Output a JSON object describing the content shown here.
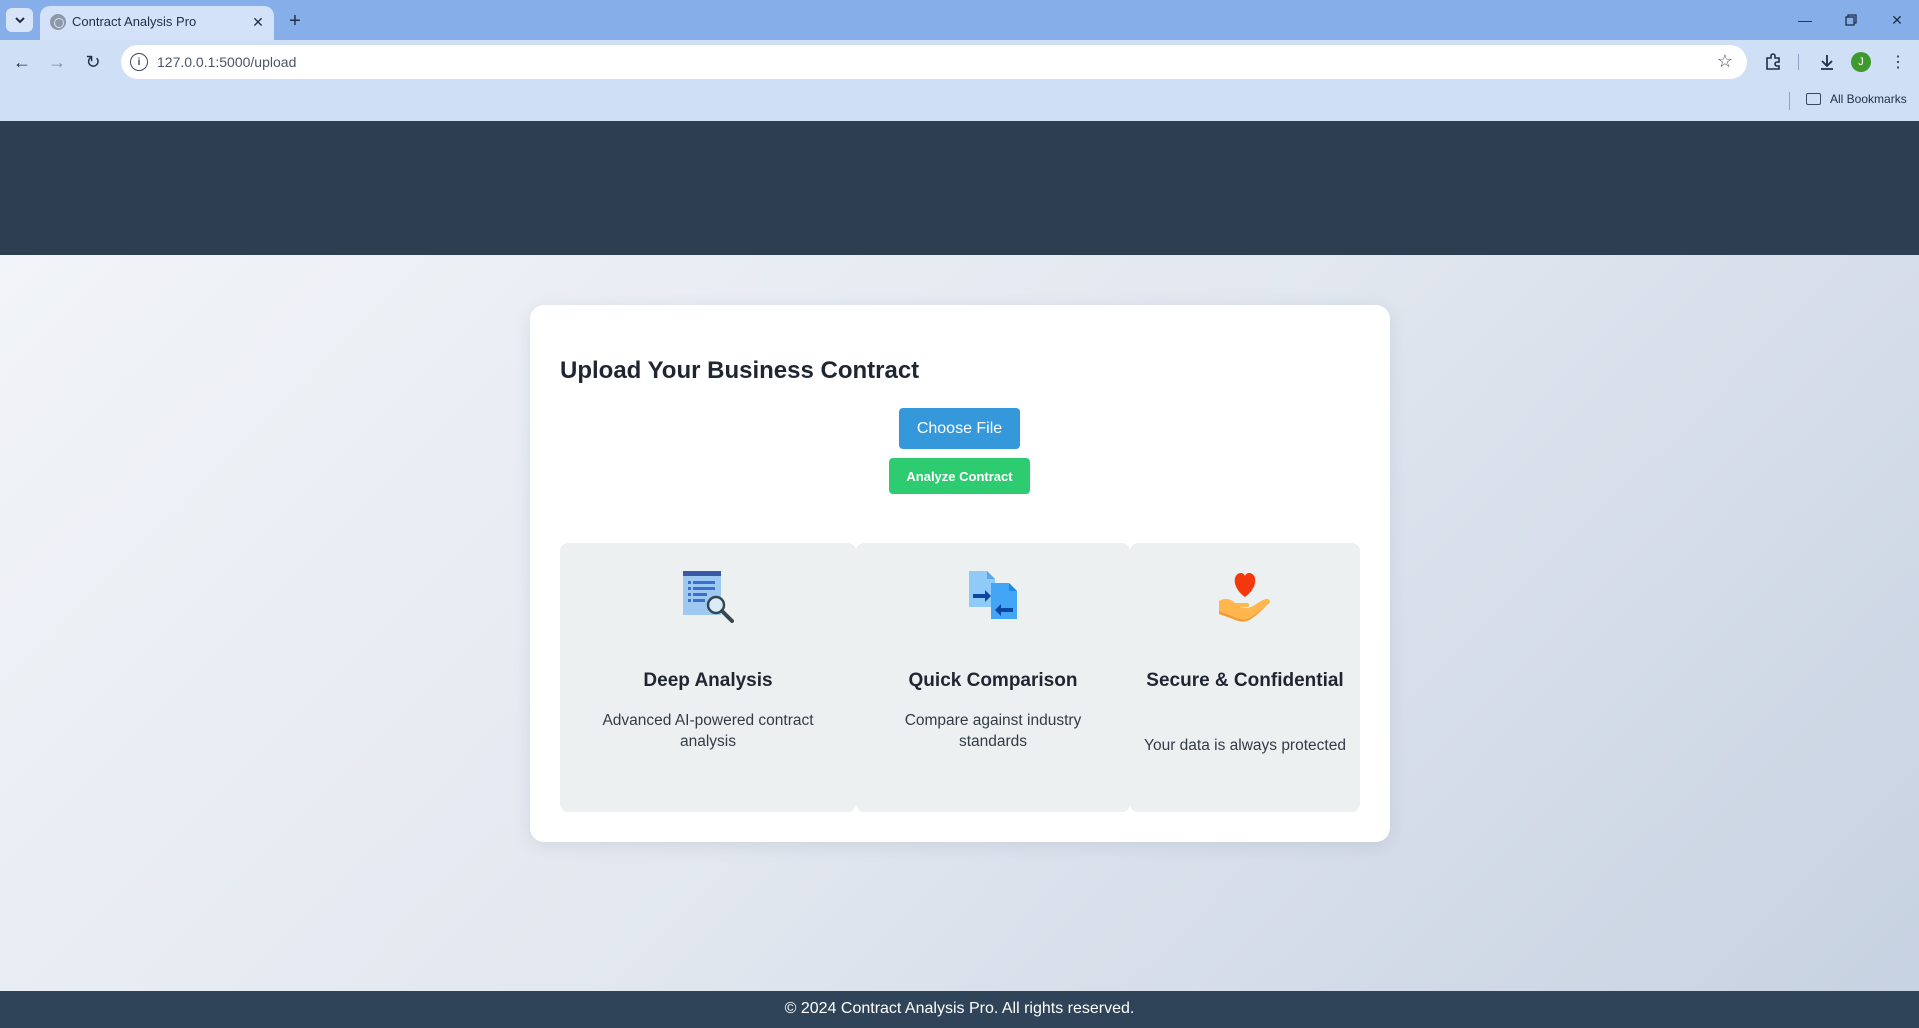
{
  "browser": {
    "tab_title": "Contract Analysis Pro",
    "url": "127.0.0.1:5000/upload",
    "bookmarks_label": "All Bookmarks",
    "profile_initial": "J"
  },
  "upload": {
    "title": "Upload Your Business Contract",
    "choose_file_label": "Choose File",
    "analyze_label": "Analyze Contract"
  },
  "features": [
    {
      "icon": "document-magnifier-icon",
      "title": "Deep Analysis",
      "description": "Advanced AI-powered contract analysis"
    },
    {
      "icon": "compare-documents-icon",
      "title": "Quick Comparison",
      "description": "Compare against industry standards"
    },
    {
      "icon": "heart-hand-icon",
      "title": "Secure & Confidential",
      "description": "Your data is always protected"
    }
  ],
  "footer": {
    "text": "© 2024 Contract Analysis Pro. All rights reserved."
  },
  "colors": {
    "header": "#2c3e50",
    "primary_button": "#3498db",
    "success_button": "#2ecc71",
    "feature_bg": "#ecf0f1"
  }
}
